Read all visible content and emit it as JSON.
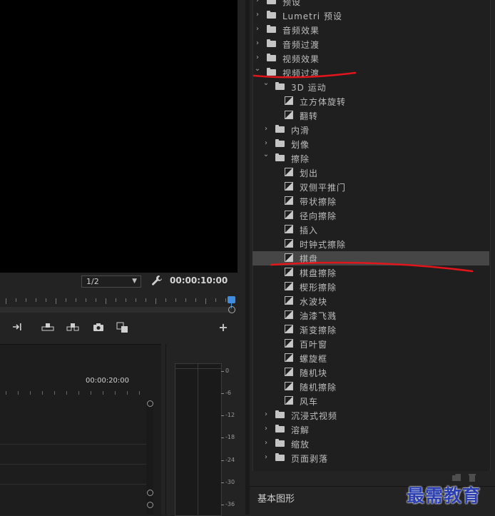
{
  "monitor": {
    "resolution": "1/2",
    "resolution_icon": "chevron-down-icon",
    "timecode": "00:00:10:00",
    "wrench_icon": "wrench-icon",
    "transport": [
      {
        "name": "insert-button",
        "icon": "insert-icon"
      },
      {
        "name": "lift-button",
        "icon": "lift-icon"
      },
      {
        "name": "extract-button",
        "icon": "extract-icon"
      },
      {
        "name": "export-frame-button",
        "icon": "camera-icon"
      },
      {
        "name": "compare-button",
        "icon": "compare-icon"
      },
      {
        "name": "button-editor",
        "icon": "plus-icon"
      }
    ]
  },
  "timeline": {
    "time_label": "00:00:20:00"
  },
  "meter": {
    "db_labels": [
      "0",
      "-6",
      "-12",
      "-18",
      "-24",
      "-30",
      "-36"
    ]
  },
  "effects": {
    "rows": [
      {
        "label": "预设",
        "type": "folder",
        "level": 0,
        "expanded": false
      },
      {
        "label": "Lumetri 预设",
        "type": "folder-star",
        "level": 0,
        "expanded": false
      },
      {
        "label": "音频效果",
        "type": "folder",
        "level": 0,
        "expanded": false
      },
      {
        "label": "音频过渡",
        "type": "folder",
        "level": 0,
        "expanded": false
      },
      {
        "label": "视频效果",
        "type": "folder",
        "level": 0,
        "expanded": false
      },
      {
        "label": "视频过渡",
        "type": "folder",
        "level": 0,
        "expanded": true
      },
      {
        "label": "3D 运动",
        "type": "folder",
        "level": 1,
        "expanded": true
      },
      {
        "label": "立方体旋转",
        "type": "fx",
        "level": 2
      },
      {
        "label": "翻转",
        "type": "fx",
        "level": 2
      },
      {
        "label": "内滑",
        "type": "folder",
        "level": 1,
        "expanded": false
      },
      {
        "label": "划像",
        "type": "folder",
        "level": 1,
        "expanded": false
      },
      {
        "label": "擦除",
        "type": "folder",
        "level": 1,
        "expanded": true
      },
      {
        "label": "划出",
        "type": "fx",
        "level": 2
      },
      {
        "label": "双侧平推门",
        "type": "fx",
        "level": 2
      },
      {
        "label": "带状擦除",
        "type": "fx",
        "level": 2
      },
      {
        "label": "径向擦除",
        "type": "fx",
        "level": 2
      },
      {
        "label": "插入",
        "type": "fx",
        "level": 2
      },
      {
        "label": "时钟式擦除",
        "type": "fx",
        "level": 2
      },
      {
        "label": "棋盘",
        "type": "fx",
        "level": 2,
        "selected": true
      },
      {
        "label": "棋盘擦除",
        "type": "fx",
        "level": 2
      },
      {
        "label": "楔形擦除",
        "type": "fx",
        "level": 2
      },
      {
        "label": "水波块",
        "type": "fx",
        "level": 2
      },
      {
        "label": "油漆飞溅",
        "type": "fx",
        "level": 2
      },
      {
        "label": "渐变擦除",
        "type": "fx",
        "level": 2
      },
      {
        "label": "百叶窗",
        "type": "fx",
        "level": 2
      },
      {
        "label": "螺旋框",
        "type": "fx",
        "level": 2
      },
      {
        "label": "随机块",
        "type": "fx",
        "level": 2
      },
      {
        "label": "随机擦除",
        "type": "fx",
        "level": 2
      },
      {
        "label": "风车",
        "type": "fx",
        "level": 2
      },
      {
        "label": "沉浸式视频",
        "type": "folder",
        "level": 1,
        "expanded": false
      },
      {
        "label": "溶解",
        "type": "folder",
        "level": 1,
        "expanded": false
      },
      {
        "label": "缩放",
        "type": "folder",
        "level": 1,
        "expanded": false
      },
      {
        "label": "页面剥落",
        "type": "folder",
        "level": 1,
        "expanded": false
      }
    ],
    "footer_icons": [
      "new-bin-icon",
      "trash-icon"
    ]
  },
  "basic_graphics": {
    "label": "基本图形"
  },
  "watermark": {
    "text": "最需教育"
  },
  "colors": {
    "accent_blue": "#3f8de0",
    "annotation_red": "#e0161b",
    "selected_row": "#464646"
  }
}
